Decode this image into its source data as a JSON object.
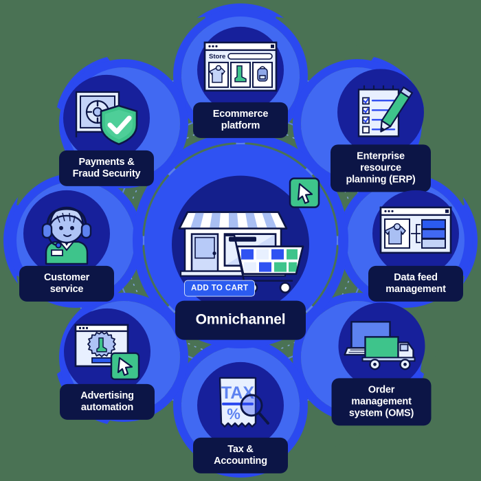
{
  "diagram": {
    "title_center": "Omnichannel",
    "background_color": "#4a7254",
    "colors": {
      "ring_bright_blue": "#2b49f0",
      "ring_light_blue": "#5d82f0",
      "node_circle_navy": "#17209b",
      "center_circle_navy": "#141f8c",
      "label_navy": "#0c1546",
      "label_text": "#ffffff",
      "accent_green": "#3ec48b",
      "cart_button_blue": "#2b5bf0"
    },
    "center": {
      "label": "Omnichannel",
      "icon": "storefront-shopping-cart-icon",
      "cta_button_label": "ADD TO CART",
      "cursor_badge": "green-cursor-icon"
    },
    "spokes": [
      {
        "id": "ecommerce-platform",
        "label": "Ecommerce\nplatform",
        "icon": "browser-store-window-icon",
        "browser_title": "Store",
        "angle_deg": -90
      },
      {
        "id": "enterprise-resource-planning",
        "label": "Enterprise resource\nplanning (ERP)",
        "icon": "checklist-notepad-pencil-icon",
        "angle_deg": -45
      },
      {
        "id": "data-feed-management",
        "label": "Data feed\nmanagement",
        "icon": "product-feed-window-icon",
        "angle_deg": 0
      },
      {
        "id": "order-management-system",
        "label": "Order management\nsystem (OMS)",
        "icon": "laptop-delivery-truck-icon",
        "angle_deg": 45
      },
      {
        "id": "tax-accounting",
        "label": "Tax &\nAccounting",
        "icon": "tax-receipt-magnifier-icon",
        "receipt_text": "TAX",
        "angle_deg": 90
      },
      {
        "id": "advertising-automation",
        "label": "Advertising\nautomation",
        "icon": "ad-window-cursor-icon",
        "angle_deg": 135
      },
      {
        "id": "customer-service",
        "label": "Customer\nservice",
        "icon": "support-agent-headset-icon",
        "angle_deg": 180
      },
      {
        "id": "payments-fraud-security",
        "label": "Payments &\nFraud Security",
        "icon": "safe-vault-shield-check-icon",
        "angle_deg": -135
      }
    ]
  }
}
